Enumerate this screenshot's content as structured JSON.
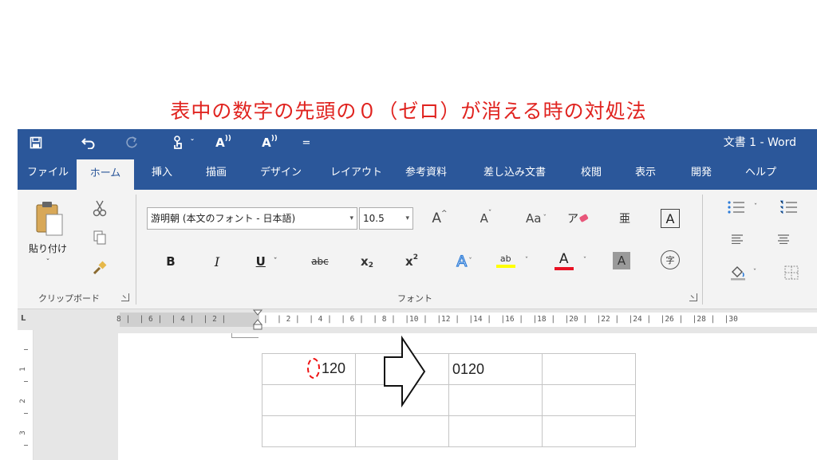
{
  "headline": "表中の数字の先頭の０（ゼロ）が消える時の対処法",
  "window": {
    "title": "文書 1  -  Word",
    "accent": "#2b579a"
  },
  "qat": {
    "read_label": "A",
    "read_label2": "A",
    "caret": "ˇ",
    "more": "="
  },
  "tabs": [
    "ファイル",
    "ホーム",
    "挿入",
    "描画",
    "デザイン",
    "レイアウト",
    "参考資料",
    "差し込み文書",
    "校閲",
    "表示",
    "開発",
    "ヘルプ"
  ],
  "clipboard": {
    "paste_label": "貼り付け",
    "paste_caret": "ˇ",
    "group_label": "クリップボード"
  },
  "font": {
    "name": "游明朝 (本文のフォント - 日本語)",
    "size": "10.5",
    "grow": "A",
    "shrink": "A",
    "case": "Aa",
    "clear_format": "ア",
    "phonetic": "亜",
    "border_char": "A",
    "bold": "B",
    "italic": "I",
    "underline": "U",
    "strike": "abc",
    "subscript": "x",
    "subscript_mark": "2",
    "superscript": "x",
    "superscript_mark": "2",
    "text_effect": "A",
    "highlight": "ab",
    "font_color": "A",
    "shading": "A",
    "enclosed": "字",
    "group_label": "フォント",
    "dd_arrow": "▾",
    "highlight_color": "#ffff00",
    "font_color_value": "#e81123"
  },
  "ruler": {
    "left_text": "8 |  | 6 |  | 4 |  | 2 |",
    "right_text": "|  | 2 |  | 4 |  | 6 |  | 8 |  |10 |  |12 |  |14 |  |16 |  |18 |  |20 |  |22 |  |24 |  |26 |  |28 |  |30",
    "corner": "L"
  },
  "vruler": [
    "1",
    "2",
    "3"
  ],
  "table": {
    "before": "120",
    "after": "0120",
    "highlight_color": "#ee1111"
  }
}
